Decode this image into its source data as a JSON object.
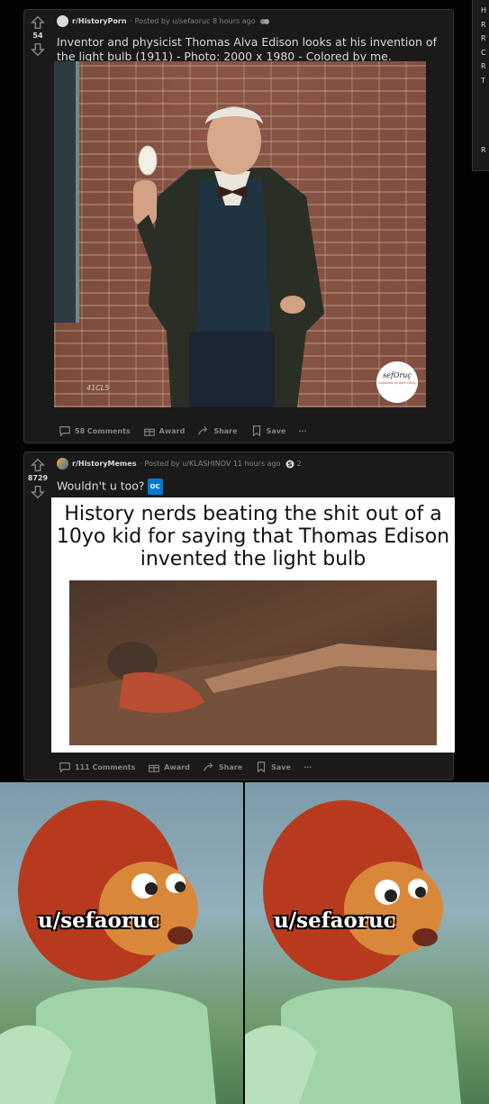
{
  "sidebar": {
    "letters": [
      "H",
      "R",
      "R",
      "C",
      "R",
      "T",
      "R"
    ]
  },
  "posts": [
    {
      "votes": "54",
      "subreddit": "r/HistoryPorn",
      "posted_by": "· Posted by u/sefaoruc 8 hours ago",
      "title": "Inventor and physicist Thomas Alva Edison looks at his invention of the light bulb (1911) - Photo: 2000 x 1980 - Colored by me.",
      "comments": "58 Comments",
      "award": "Award",
      "share": "Share",
      "save": "Save",
      "more": "···",
      "photo_caption": "sefOruç",
      "photo_subcaption": "Colorized by Sefa ORUÇ",
      "photo_mark": "41CL5"
    },
    {
      "votes": "8729",
      "subreddit": "r/HistoryMemes",
      "posted_by": "· Posted by u/KLASHINOV 11 hours ago",
      "award_count": "2",
      "title": "Wouldn't u too?",
      "flair": "OC",
      "meme_text": "History nerds beating the shit out of a 10yo kid for saying that Thomas Edison invented the light bulb",
      "comments": "111 Comments",
      "award": "Award",
      "share": "Share",
      "save": "Save",
      "more": "···"
    }
  ],
  "reaction": {
    "left_label": "u/sefaoruc",
    "right_label": "u/sefaoruc"
  },
  "colors": {
    "background": "#030303",
    "card": "#1a1a1b",
    "border": "#343536",
    "text": "#d7dadc",
    "muted": "#818384",
    "oc_flair": "#0079d3"
  }
}
